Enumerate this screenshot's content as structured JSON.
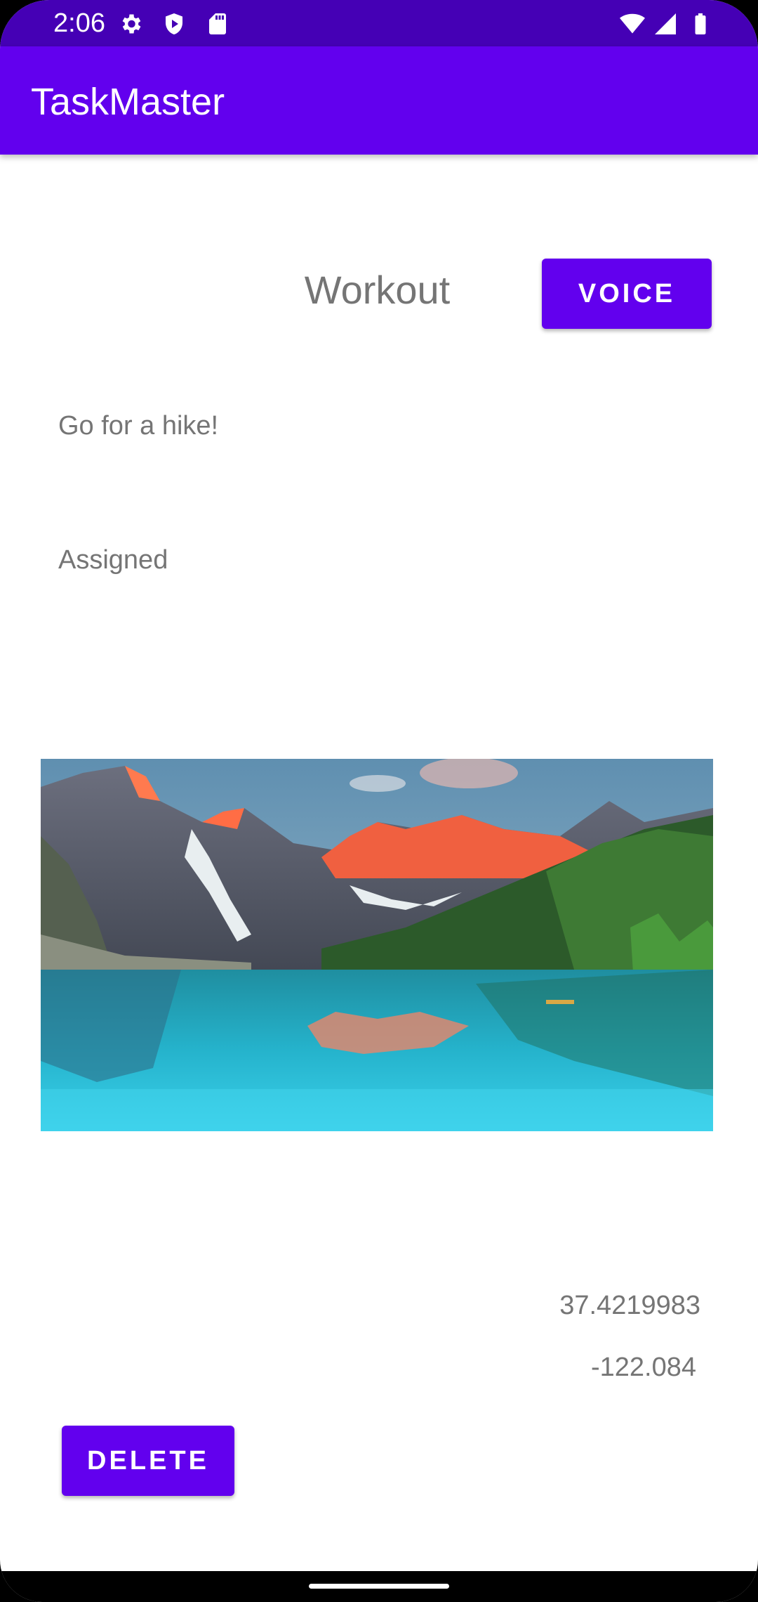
{
  "status_bar": {
    "time": "2:06",
    "icons": [
      "settings-icon",
      "play-protect-icon",
      "sd-card-icon",
      "wifi-icon",
      "cell-signal-icon",
      "battery-icon"
    ]
  },
  "app_bar": {
    "title": "TaskMaster"
  },
  "task": {
    "title": "Workout",
    "description": "Go for a hike!",
    "state": "Assigned",
    "latitude": "37.4219983",
    "longitude": "-122.084"
  },
  "buttons": {
    "voice_label": "VOICE",
    "delete_label": "DELETE"
  },
  "colors": {
    "primary": "#6200ee",
    "status_bar": "#4500b5",
    "secondary_text": "#757575"
  }
}
